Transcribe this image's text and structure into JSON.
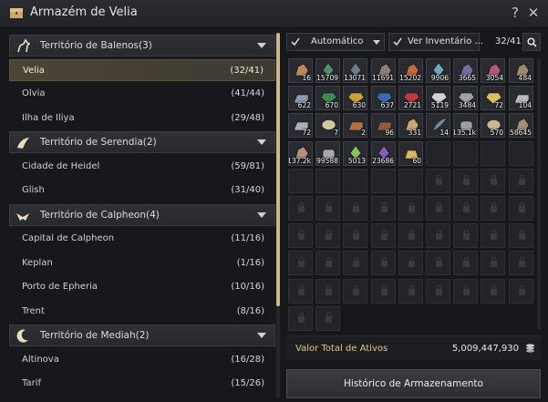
{
  "window": {
    "title": "Armazém de Velia",
    "help_label": "?",
    "close_label": "✕"
  },
  "regions": [
    {
      "label": "Território de Balenos(3)",
      "icon": "horse-icon",
      "towns": [
        {
          "name": "Velia",
          "count": "(32/41)",
          "selected": true
        },
        {
          "name": "Olvia",
          "count": "(41/44)"
        },
        {
          "name": "Ilha de Iliya",
          "count": "(29/48)"
        }
      ]
    },
    {
      "label": "Território de Serendia(2)",
      "icon": "wing-icon",
      "towns": [
        {
          "name": "Cidade de Heidel",
          "count": "(59/81)"
        },
        {
          "name": "Glish",
          "count": "(31/40)"
        }
      ]
    },
    {
      "label": "Território de Calpheon(4)",
      "icon": "bird-icon",
      "towns": [
        {
          "name": "Capital de Calpheon",
          "count": "(11/16)"
        },
        {
          "name": "Keplan",
          "count": "(1/16)"
        },
        {
          "name": "Porto de Epheria",
          "count": "(10/16)"
        },
        {
          "name": "Trent",
          "count": "(8/16)"
        }
      ]
    },
    {
      "label": "Território de Mediah(2)",
      "icon": "moon-icon",
      "towns": [
        {
          "name": "Altinova",
          "count": "(16/28)"
        },
        {
          "name": "Tarif",
          "count": "(15/26)"
        }
      ]
    }
  ],
  "toolbar": {
    "sort_label": "Automático",
    "inventory_label": "Ver Inventário ...",
    "capacity": "32/41"
  },
  "items": [
    {
      "qty": "16",
      "color": "#b98a5a",
      "icon": "ore-icon"
    },
    {
      "qty": "15709",
      "color": "#4f8e6a",
      "icon": "crystal-icon"
    },
    {
      "qty": "13071",
      "color": "#6e7a8c",
      "icon": "crystal-icon"
    },
    {
      "qty": "11691",
      "color": "#8c7e70",
      "icon": "ore-icon"
    },
    {
      "qty": "15202",
      "color": "#c06a3a",
      "icon": "ore-icon"
    },
    {
      "qty": "9906",
      "color": "#6fa8c4",
      "icon": "crystal-icon"
    },
    {
      "qty": "3665",
      "color": "#7a6a9e",
      "icon": "ore-icon"
    },
    {
      "qty": "3054",
      "color": "#b05a7a",
      "icon": "ore-icon"
    },
    {
      "qty": "484",
      "color": "#9e8a66",
      "icon": "ore-icon"
    },
    {
      "qty": "622",
      "color": "#8c9ab0",
      "icon": "ingot-icon"
    },
    {
      "qty": "670",
      "color": "#3c8a5a",
      "icon": "gem-icon"
    },
    {
      "qty": "630",
      "color": "#c9a23c",
      "icon": "gem-icon"
    },
    {
      "qty": "637",
      "color": "#3c6ab0",
      "icon": "gem-icon"
    },
    {
      "qty": "2721",
      "color": "#c03c3c",
      "icon": "gem-icon"
    },
    {
      "qty": "5119",
      "color": "#d0d0d8",
      "icon": "gem-icon"
    },
    {
      "qty": "3484",
      "color": "#a0a0a8",
      "icon": "gem-icon"
    },
    {
      "qty": "72",
      "color": "#d8c060",
      "icon": "gem-icon"
    },
    {
      "qty": "104",
      "color": "#b8b8c0",
      "icon": "ingot-icon"
    },
    {
      "qty": "72",
      "color": "#a8b0b8",
      "icon": "ingot-icon"
    },
    {
      "qty": "7",
      "color": "#cfc8a0",
      "icon": "shell-icon"
    },
    {
      "qty": "2",
      "color": "#b07040",
      "icon": "ingot-icon"
    },
    {
      "qty": "96",
      "color": "#8c5a3c",
      "icon": "ingot-icon"
    },
    {
      "qty": "331",
      "color": "#c8a878",
      "icon": "ore-icon"
    },
    {
      "qty": "14",
      "color": "#7a8a9a",
      "icon": "feather-icon"
    },
    {
      "qty": "135.1k",
      "color": "#9aa0a8",
      "icon": "stone-icon"
    },
    {
      "qty": "570",
      "color": "#c8b890",
      "icon": "shell-icon"
    },
    {
      "qty": "58645",
      "color": "#a09070",
      "icon": "ore-icon"
    },
    {
      "qty": "137.2k",
      "color": "#b09080",
      "icon": "ore-icon"
    },
    {
      "qty": "99588",
      "color": "#a8a8b0",
      "icon": "stone-icon"
    },
    {
      "qty": "5013",
      "color": "#8cc05a",
      "icon": "crystal-icon"
    },
    {
      "qty": "23686",
      "color": "#8a5ac0",
      "icon": "crystal-icon"
    },
    {
      "qty": "60",
      "color": "#d8b860",
      "icon": "pouch-icon"
    }
  ],
  "empty_open_slots": 9,
  "locked_slots": 42,
  "footer": {
    "total_label": "Valor Total de Ativos",
    "total_value": "5,009,447,930",
    "history_label": "Histórico de Armazenamento"
  },
  "colors": {
    "accent": "#e2c877",
    "selected_row": "#4a4537"
  }
}
